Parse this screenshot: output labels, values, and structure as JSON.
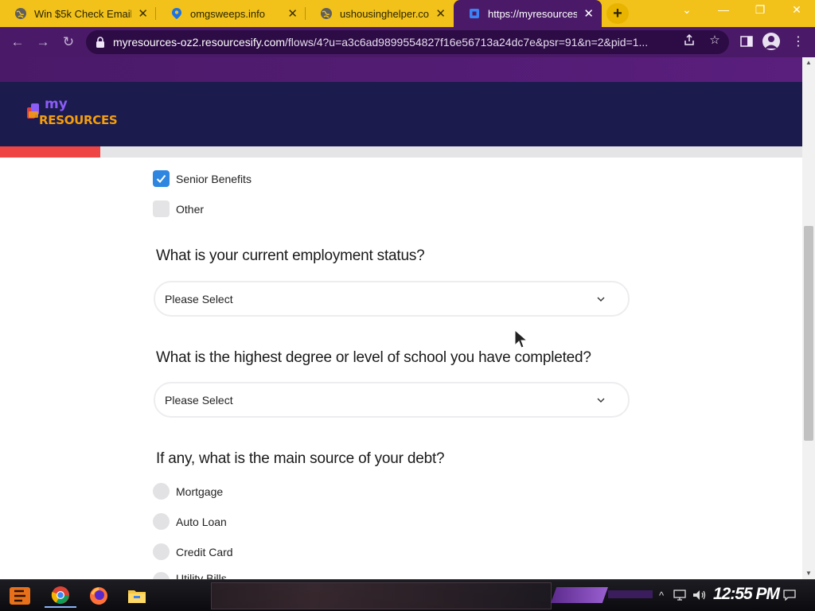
{
  "browser": {
    "tabs": [
      {
        "title": "Win $5k Check Email",
        "favicon": "globe-icon",
        "active": false
      },
      {
        "title": "omgsweeps.info",
        "favicon": "map-pin-icon",
        "active": false
      },
      {
        "title": "ushousinghelper.com",
        "favicon": "globe-icon",
        "active": false
      },
      {
        "title": "https://myresources-",
        "favicon": "square-icon",
        "active": true
      }
    ],
    "new_tab_label": "+",
    "url_domain": "myresources-oz2.resourcesify.com",
    "url_path": "/flows/4?u=a3c6ad9899554827f16e56713a24dc7e&psr=91&n=2&pid=1..."
  },
  "site": {
    "logo_top": "my",
    "logo_bottom": "RESOURCES",
    "progress_fraction": 0.125
  },
  "form": {
    "checkbox_options": [
      {
        "label": "Senior Benefits",
        "checked": true
      },
      {
        "label": "Other",
        "checked": false
      }
    ],
    "employment_question": "What is your current employment status?",
    "employment_select": "Please Select",
    "education_question": "What is the highest degree or level of school you have completed?",
    "education_select": "Please Select",
    "debt_question": "If any, what is the main source of your debt?",
    "debt_options": [
      "Mortgage",
      "Auto Loan",
      "Credit Card",
      "Utility Bills"
    ]
  },
  "taskbar": {
    "clock": "12:55 PM"
  },
  "colors": {
    "tab_strip": "#f2c21b",
    "browser_chrome": "#4a1a68",
    "site_header": "#1b1b4d",
    "progress": "#ef4444",
    "checkbox_checked": "#2f86e0"
  }
}
